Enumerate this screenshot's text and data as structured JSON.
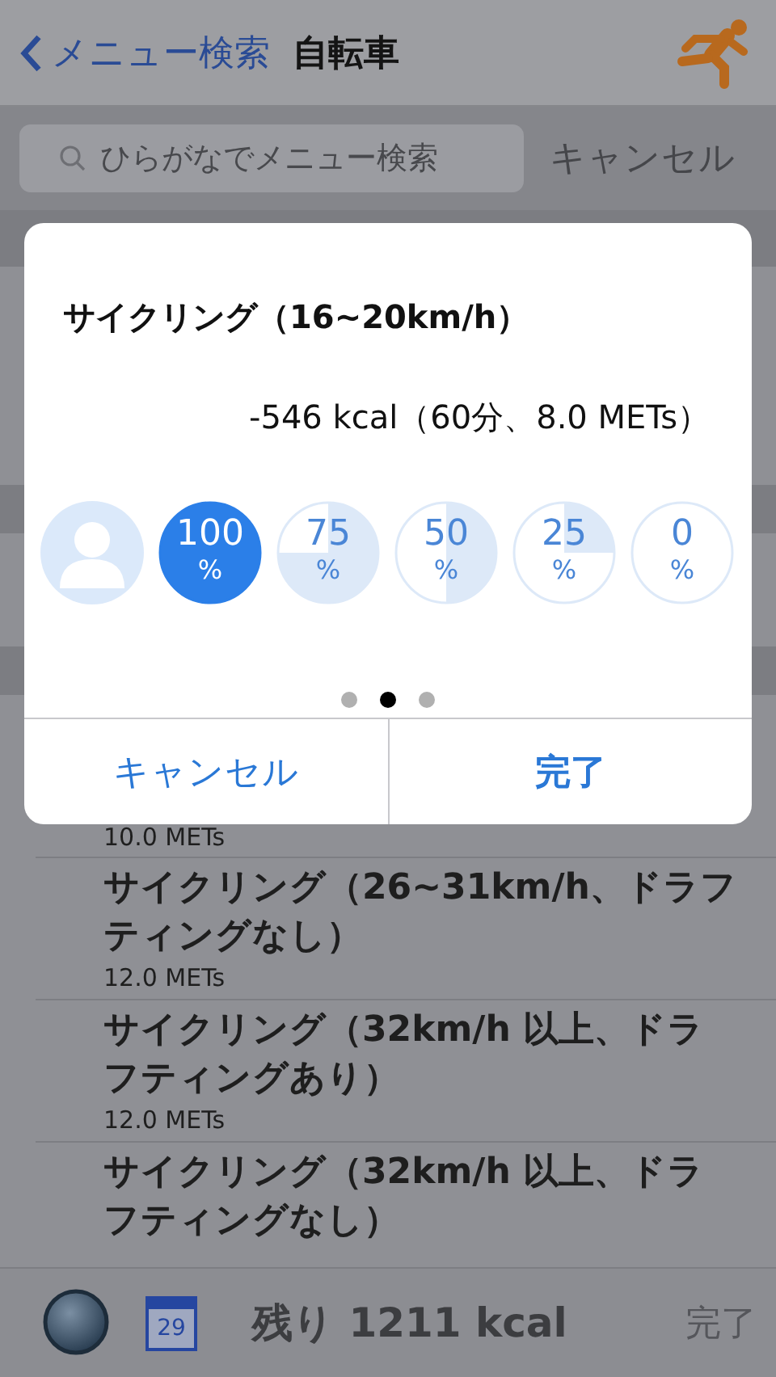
{
  "nav": {
    "back": "メニュー検索",
    "title": "自転車"
  },
  "search": {
    "placeholder": "ひらがなでメニュー検索",
    "cancel": "キャンセル"
  },
  "list": {
    "partial_meta": "10.0 METs",
    "rows": [
      {
        "title": "サイクリング（26~31km/h、ドラフティングなし）",
        "meta": "12.0 METs"
      },
      {
        "title": "サイクリング（32km/h 以上、ドラフティングあり）",
        "meta": "12.0 METs"
      },
      {
        "title": "サイクリング（32km/h 以上、ドラフティングなし）"
      }
    ]
  },
  "dialog": {
    "title": "サイクリング（16~20km/h）",
    "detail": "-546 kcal（60分、8.0 METs）",
    "options": [
      {
        "kind": "avatar",
        "selected": false
      },
      {
        "kind": "full",
        "value": "100",
        "unit": "%",
        "selected": true
      },
      {
        "kind": "three_quarters",
        "value": "75",
        "unit": "%",
        "selected": false
      },
      {
        "kind": "half",
        "value": "50",
        "unit": "%",
        "selected": false
      },
      {
        "kind": "quarter",
        "value": "25",
        "unit": "%",
        "selected": false
      },
      {
        "kind": "empty",
        "value": "0",
        "unit": "%",
        "selected": false
      }
    ],
    "pages": [
      {
        "selected": false
      },
      {
        "selected": true
      },
      {
        "selected": false
      }
    ],
    "cancel": "キャンセル",
    "done": "完了"
  },
  "toolbar": {
    "date": "29",
    "remaining": "残り 1211 kcal",
    "done": {
      "label": "完了",
      "disabled": true
    }
  }
}
